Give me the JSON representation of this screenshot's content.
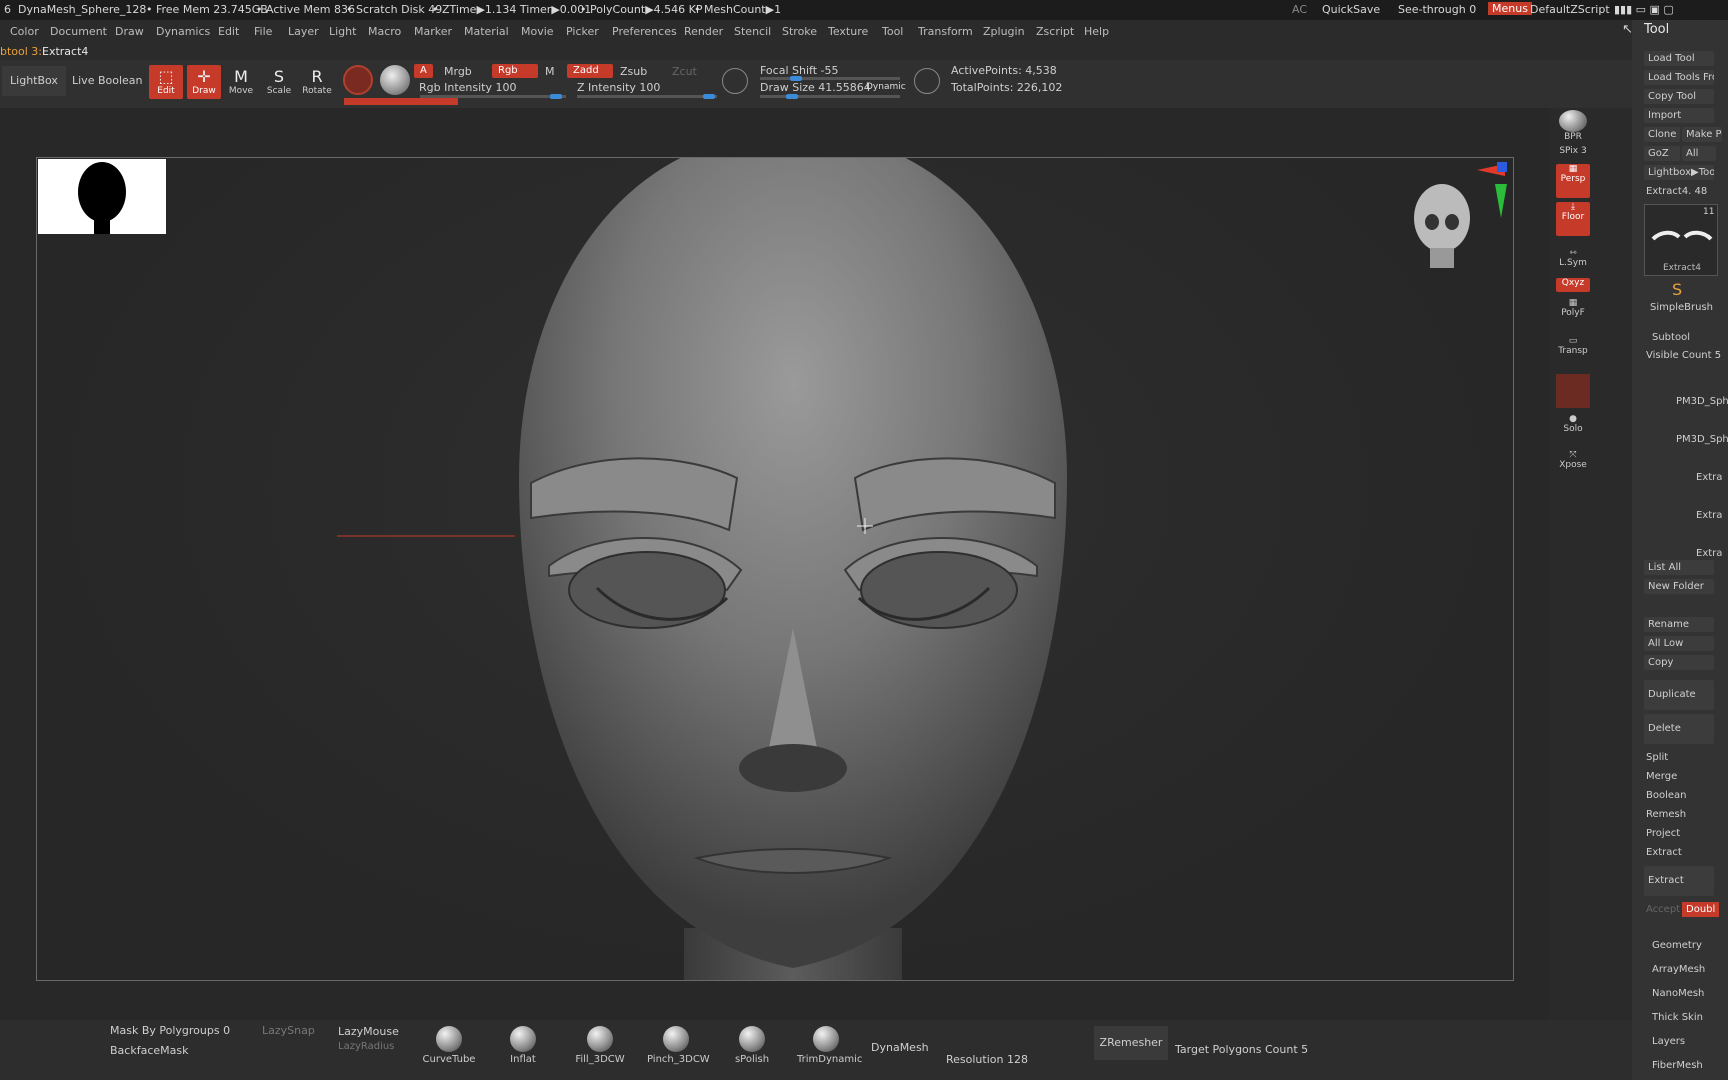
{
  "titlebar": {
    "project": "DynaMesh_Sphere_128",
    "free_mem": "• Free Mem 23.745GB",
    "active_mem": "• Active Mem 836",
    "scratch": "• Scratch Disk 49",
    "ztime": "• ZTime▶1.134 Timer▶0.001",
    "polycount": "• PolyCount▶4.546 KP",
    "meshcount": "• MeshCount▶1",
    "ac": "AC",
    "quicksave": "QuickSave",
    "seethrough": "See-through 0",
    "menus": "Menus",
    "script": "DefaultZScript"
  },
  "menu": [
    "Color",
    "Document",
    "Draw",
    "Dynamics",
    "Edit",
    "File",
    "Layer",
    "Light",
    "Macro",
    "Marker",
    "Material",
    "Movie",
    "Picker",
    "Preferences",
    "Render",
    "Stencil",
    "Stroke",
    "Texture",
    "Tool",
    "Transform",
    "Zplugin",
    "Zscript",
    "Help"
  ],
  "subtool_label": "btool 3:",
  "subtool_name": "Extract4",
  "toolbar": {
    "lightbox": "LightBox",
    "live_boolean": "Live Boolean",
    "edit": "Edit",
    "draw": "Draw",
    "move": "Move",
    "scale": "Scale",
    "rotate": "Rotate",
    "a": "A",
    "mrgb": "Mrgb",
    "rgb": "Rgb",
    "m": "M",
    "rgb_intensity": "Rgb Intensity 100",
    "zadd": "Zadd",
    "zsub": "Zsub",
    "zcut": "Zcut",
    "z_intensity": "Z Intensity 100",
    "focal_shift": "Focal Shift -55",
    "draw_size": "Draw Size 41.55864",
    "dynamic": "Dynamic",
    "active_points": "ActivePoints: 4,538",
    "total_points": "TotalPoints: 226,102"
  },
  "shelf": {
    "bpr": "BPR",
    "spix": "SPix 3",
    "persp": "Persp",
    "floor": "Floor",
    "lsym": "L.Sym",
    "xyz": "Qxyz",
    "polyf": "PolyF",
    "transp": "Transp",
    "solo": "Solo",
    "xpose": "Xpose"
  },
  "tool_panel": {
    "title": "Tool",
    "load_tool": "Load Tool",
    "load_tools_from": "Load Tools From",
    "copy_tool": "Copy Tool",
    "import": "Import",
    "clone": "Clone",
    "make_poly": "Make Pol",
    "goz": "GoZ",
    "all": "All",
    "lightbox_tools": "Lightbox▶Tools",
    "extract_count": "Extract4. 48",
    "thumb_label": "Extract4",
    "thumb_count": "11",
    "simplebrush": "SimpleBrush",
    "subtool": "Subtool",
    "visible_count": "Visible Count 5",
    "items": [
      "PM3D_Sph",
      "PM3D_Sph",
      "Extra",
      "Extra",
      "Extra"
    ],
    "list_all": "List All",
    "new_folder": "New Folder",
    "rename": "Rename",
    "all_low": "All Low",
    "copy": "Copy",
    "duplicate": "Duplicate",
    "delete": "Delete",
    "split": "Split",
    "merge": "Merge",
    "boolean": "Boolean",
    "remesh": "Remesh",
    "project": "Project",
    "extract_head": "Extract",
    "extract_btn": "Extract",
    "accept": "Accept",
    "double": "Doubl",
    "geometry": "Geometry",
    "arraymesh": "ArrayMesh",
    "nanomesh": "NanoMesh",
    "thick_skin": "Thick Skin",
    "layers": "Layers",
    "fibermesh": "FiberMesh"
  },
  "bottom": {
    "mask_polygroups": "Mask By Polygroups 0",
    "lazysnap": "LazySnap",
    "lazymouse": "LazyMouse",
    "lazyradius": "LazyRadius",
    "backfacemask": "BackfaceMask",
    "brushes": [
      "CurveTube",
      "Inflat",
      "Fill_3DCW",
      "Pinch_3DCW",
      "sPolish",
      "TrimDynamic"
    ],
    "dynamesh": "DynaMesh",
    "resolution": "Resolution 128",
    "zremesher": "ZRemesher",
    "target_polys": "Target Polygons Count 5"
  }
}
